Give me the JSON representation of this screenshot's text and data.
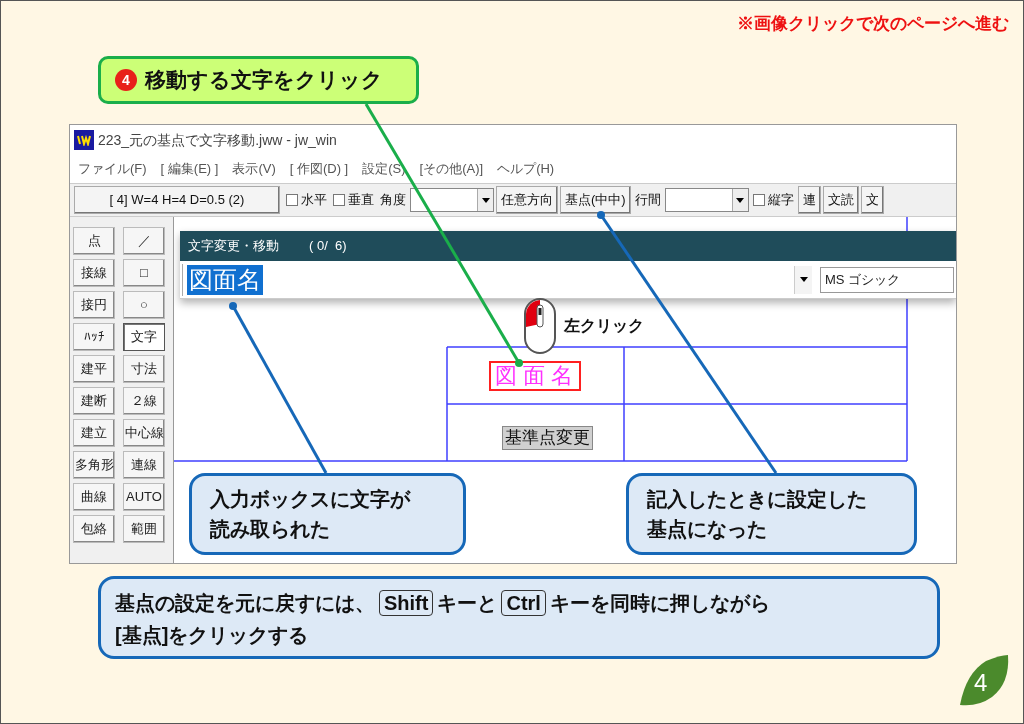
{
  "page_note": "※画像クリックで次のページへ進む",
  "step_callout": {
    "number": "4",
    "text": "移動する文字をクリック"
  },
  "window": {
    "title": "223_元の基点で文字移動.jww - jw_win",
    "menu": [
      "ファイル(F)",
      "[ 編集(E) ]",
      "表示(V)",
      "[ 作図(D) ]",
      "設定(S)",
      "[その他(A)]",
      "ヘルプ(H)"
    ],
    "toolbar": [
      {
        "kind": "button",
        "label": "[ 4]  W=4 H=4 D=0.5 (2)"
      },
      {
        "kind": "checkbox",
        "label": "水平",
        "checked": false
      },
      {
        "kind": "checkbox",
        "label": "垂直",
        "checked": false
      },
      {
        "kind": "label",
        "label": "角度"
      },
      {
        "kind": "combo"
      },
      {
        "kind": "button",
        "label": "任意方向"
      },
      {
        "kind": "button",
        "label": "基点(中中)"
      },
      {
        "kind": "label",
        "label": "行間"
      },
      {
        "kind": "combo"
      },
      {
        "kind": "checkbox",
        "label": "縦字",
        "checked": false
      },
      {
        "kind": "button",
        "label": "連"
      },
      {
        "kind": "button",
        "label": "文読"
      },
      {
        "kind": "button",
        "label": "文"
      }
    ],
    "palette_left": [
      {
        "label": "点",
        "selected": false
      },
      {
        "label": "接線",
        "selected": false
      },
      {
        "label": "接円",
        "selected": false
      },
      {
        "label": "ﾊｯﾁ",
        "selected": false
      },
      {
        "label": "建平",
        "selected": false
      },
      {
        "label": "建断",
        "selected": false
      },
      {
        "label": "建立",
        "selected": false
      },
      {
        "label": "多角形",
        "selected": false
      },
      {
        "label": "曲線",
        "selected": false
      },
      {
        "label": "包絡",
        "selected": false
      }
    ],
    "palette_right": [
      {
        "label": "／",
        "selected": false
      },
      {
        "label": "□",
        "selected": false
      },
      {
        "label": "○",
        "selected": false
      },
      {
        "label": "文字",
        "selected": true
      },
      {
        "label": "寸法",
        "selected": false
      },
      {
        "label": "２線",
        "selected": false
      },
      {
        "label": "中心線",
        "selected": false
      },
      {
        "label": "連線",
        "selected": false
      },
      {
        "label": "AUTO",
        "selected": false
      },
      {
        "label": "範囲",
        "selected": false
      }
    ],
    "dialog": {
      "title": "文字変更・移動",
      "counter": "( 0/  6)",
      "value": "図面名",
      "font": "MS ゴシック"
    },
    "drawing": {
      "picked_text": "図面名",
      "base_point_label": "基準点変更"
    },
    "mouse_label": "左クリック"
  },
  "callouts": [
    {
      "lines": [
        "入力ボックスに文字が",
        "読み取られた"
      ]
    },
    {
      "lines": [
        "記入したときに設定した",
        "基点になった"
      ]
    }
  ],
  "instruction": [
    [
      {
        "kind": "text",
        "text": "基点の設定を元に戻すには、"
      },
      {
        "kind": "key",
        "text": "Shift"
      },
      {
        "kind": "text",
        "text": "キーと"
      },
      {
        "kind": "key",
        "text": "Ctrl"
      },
      {
        "kind": "text",
        "text": "キーを同時に押しながら"
      }
    ],
    [
      {
        "kind": "text",
        "text": "[基点]をクリックする"
      }
    ]
  ],
  "page_number": "4"
}
